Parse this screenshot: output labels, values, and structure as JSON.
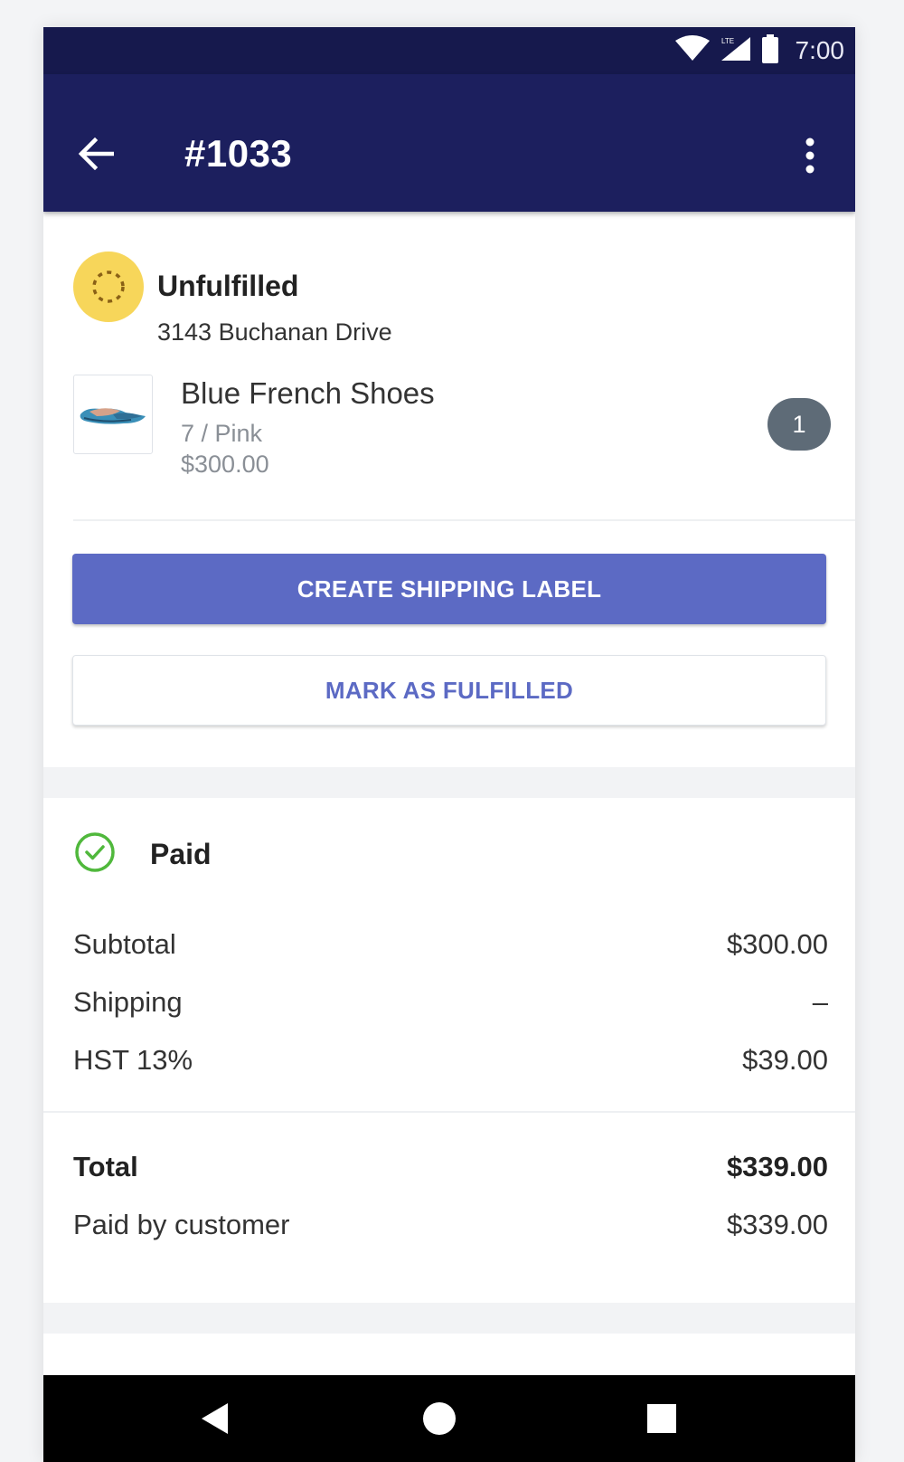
{
  "status_bar": {
    "time": "7:00",
    "icons": [
      "wifi-icon",
      "signal-icon",
      "battery-icon"
    ]
  },
  "app_bar": {
    "title": "#1033",
    "back_icon": "arrow-left-icon",
    "menu_icon": "more-vertical-icon"
  },
  "fulfillment": {
    "status": "Unfulfilled",
    "address": "3143 Buchanan Drive",
    "status_color": "#f7d65a",
    "item": {
      "name": "Blue French Shoes",
      "variant": "7 / Pink",
      "price": "$300.00",
      "quantity": "1"
    },
    "primary_button": "CREATE SHIPPING LABEL",
    "secondary_button": "MARK AS FULFILLED"
  },
  "payment": {
    "status": "Paid",
    "status_color": "#50b83c",
    "lines": [
      {
        "label": "Subtotal",
        "value": "$300.00"
      },
      {
        "label": "Shipping",
        "value": "–"
      },
      {
        "label": "HST 13%",
        "value": "$39.00"
      }
    ],
    "total": {
      "label": "Total",
      "value": "$339.00"
    },
    "paid_by_customer": {
      "label": "Paid by customer",
      "value": "$339.00"
    }
  },
  "colors": {
    "app_bar": "#1c1f5e",
    "accent": "#5c6ac4",
    "badge": "#5e6b77"
  },
  "nav_bar": {
    "icons": [
      "back-triangle-icon",
      "home-circle-icon",
      "recents-square-icon"
    ]
  }
}
